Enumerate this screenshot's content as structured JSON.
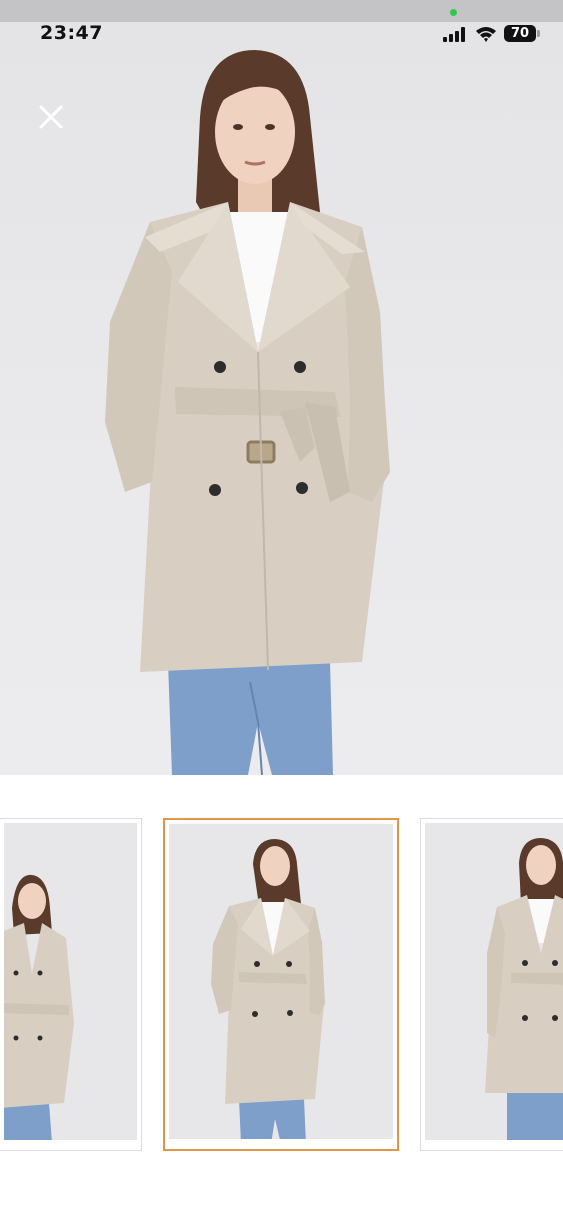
{
  "status_bar": {
    "time": "23:47",
    "battery_level": "70",
    "icons": [
      "signal-icon",
      "wifi-icon",
      "battery-icon"
    ]
  },
  "viewer": {
    "close_icon": "close-icon",
    "main_image_alt": "",
    "selected_index": 1
  },
  "thumbnails": [
    {
      "name": "thumbnail-1",
      "selected": false
    },
    {
      "name": "thumbnail-2",
      "selected": true
    },
    {
      "name": "thumbnail-3",
      "selected": false
    }
  ],
  "colors": {
    "selection_border": "#e0954b",
    "coat": "#d8cfc2",
    "jeans": "#7d9fc9"
  }
}
